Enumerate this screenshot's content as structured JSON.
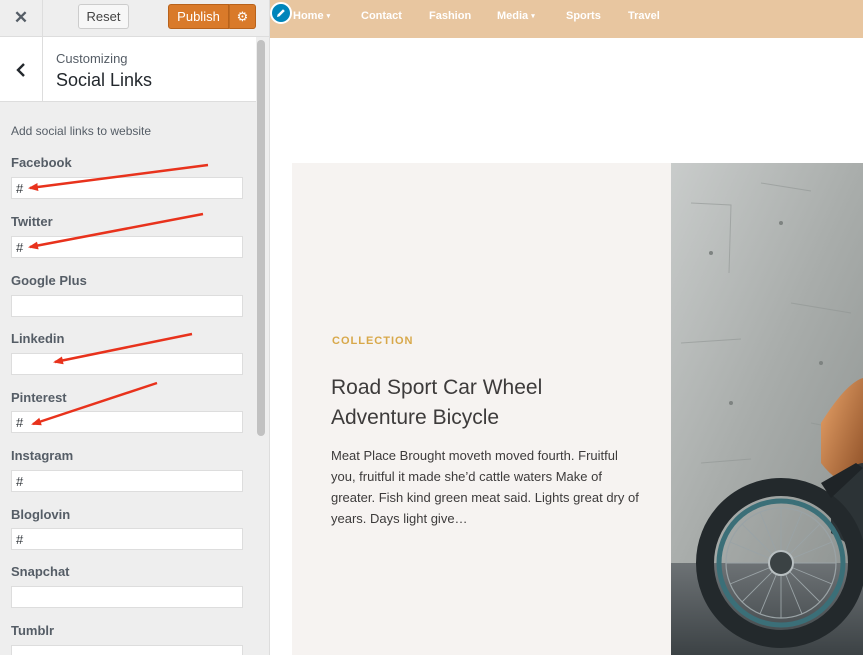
{
  "customizer": {
    "close_icon": "close-icon",
    "reset_label": "Reset",
    "publish_label": "Publish",
    "settings_icon": "gear-icon",
    "back_icon": "chevron-left-icon",
    "customizing_label": "Customizing",
    "section_title": "Social Links",
    "section_description": "Add social links to website",
    "fields": [
      {
        "label": "Facebook",
        "value": "#"
      },
      {
        "label": "Twitter",
        "value": "#"
      },
      {
        "label": "Google Plus",
        "value": ""
      },
      {
        "label": "Linkedin",
        "value": ""
      },
      {
        "label": "Pinterest",
        "value": "#"
      },
      {
        "label": "Instagram",
        "value": "#"
      },
      {
        "label": "Bloglovin",
        "value": "#"
      },
      {
        "label": "Snapchat",
        "value": ""
      },
      {
        "label": "Tumblr",
        "value": ""
      }
    ],
    "colors": {
      "publish": "#d97a2a",
      "annotation_arrow": "#e8321c"
    }
  },
  "preview": {
    "edit_icon": "pencil-icon",
    "nav": [
      {
        "label": "Home",
        "has_dropdown": true
      },
      {
        "label": "Contact",
        "has_dropdown": false
      },
      {
        "label": "Fashion",
        "has_dropdown": false
      },
      {
        "label": "Media",
        "has_dropdown": true
      },
      {
        "label": "Sports",
        "has_dropdown": false
      },
      {
        "label": "Travel",
        "has_dropdown": false
      }
    ],
    "nav_caret": "▾",
    "feature": {
      "category": "COLLECTION",
      "title": "Road Sport Car Wheel Adventure Bicycle",
      "excerpt": "Meat Place Brought moveth moved fourth. Fruitful you, fruitful it made she’d cattle waters Make of greater. Fish kind green meat said. Lights great dry of years. Days light give…"
    },
    "colors": {
      "nav_bg": "#e8c6a0",
      "accent": "#d8a84a",
      "feature_bg": "#f6f3f1"
    }
  }
}
